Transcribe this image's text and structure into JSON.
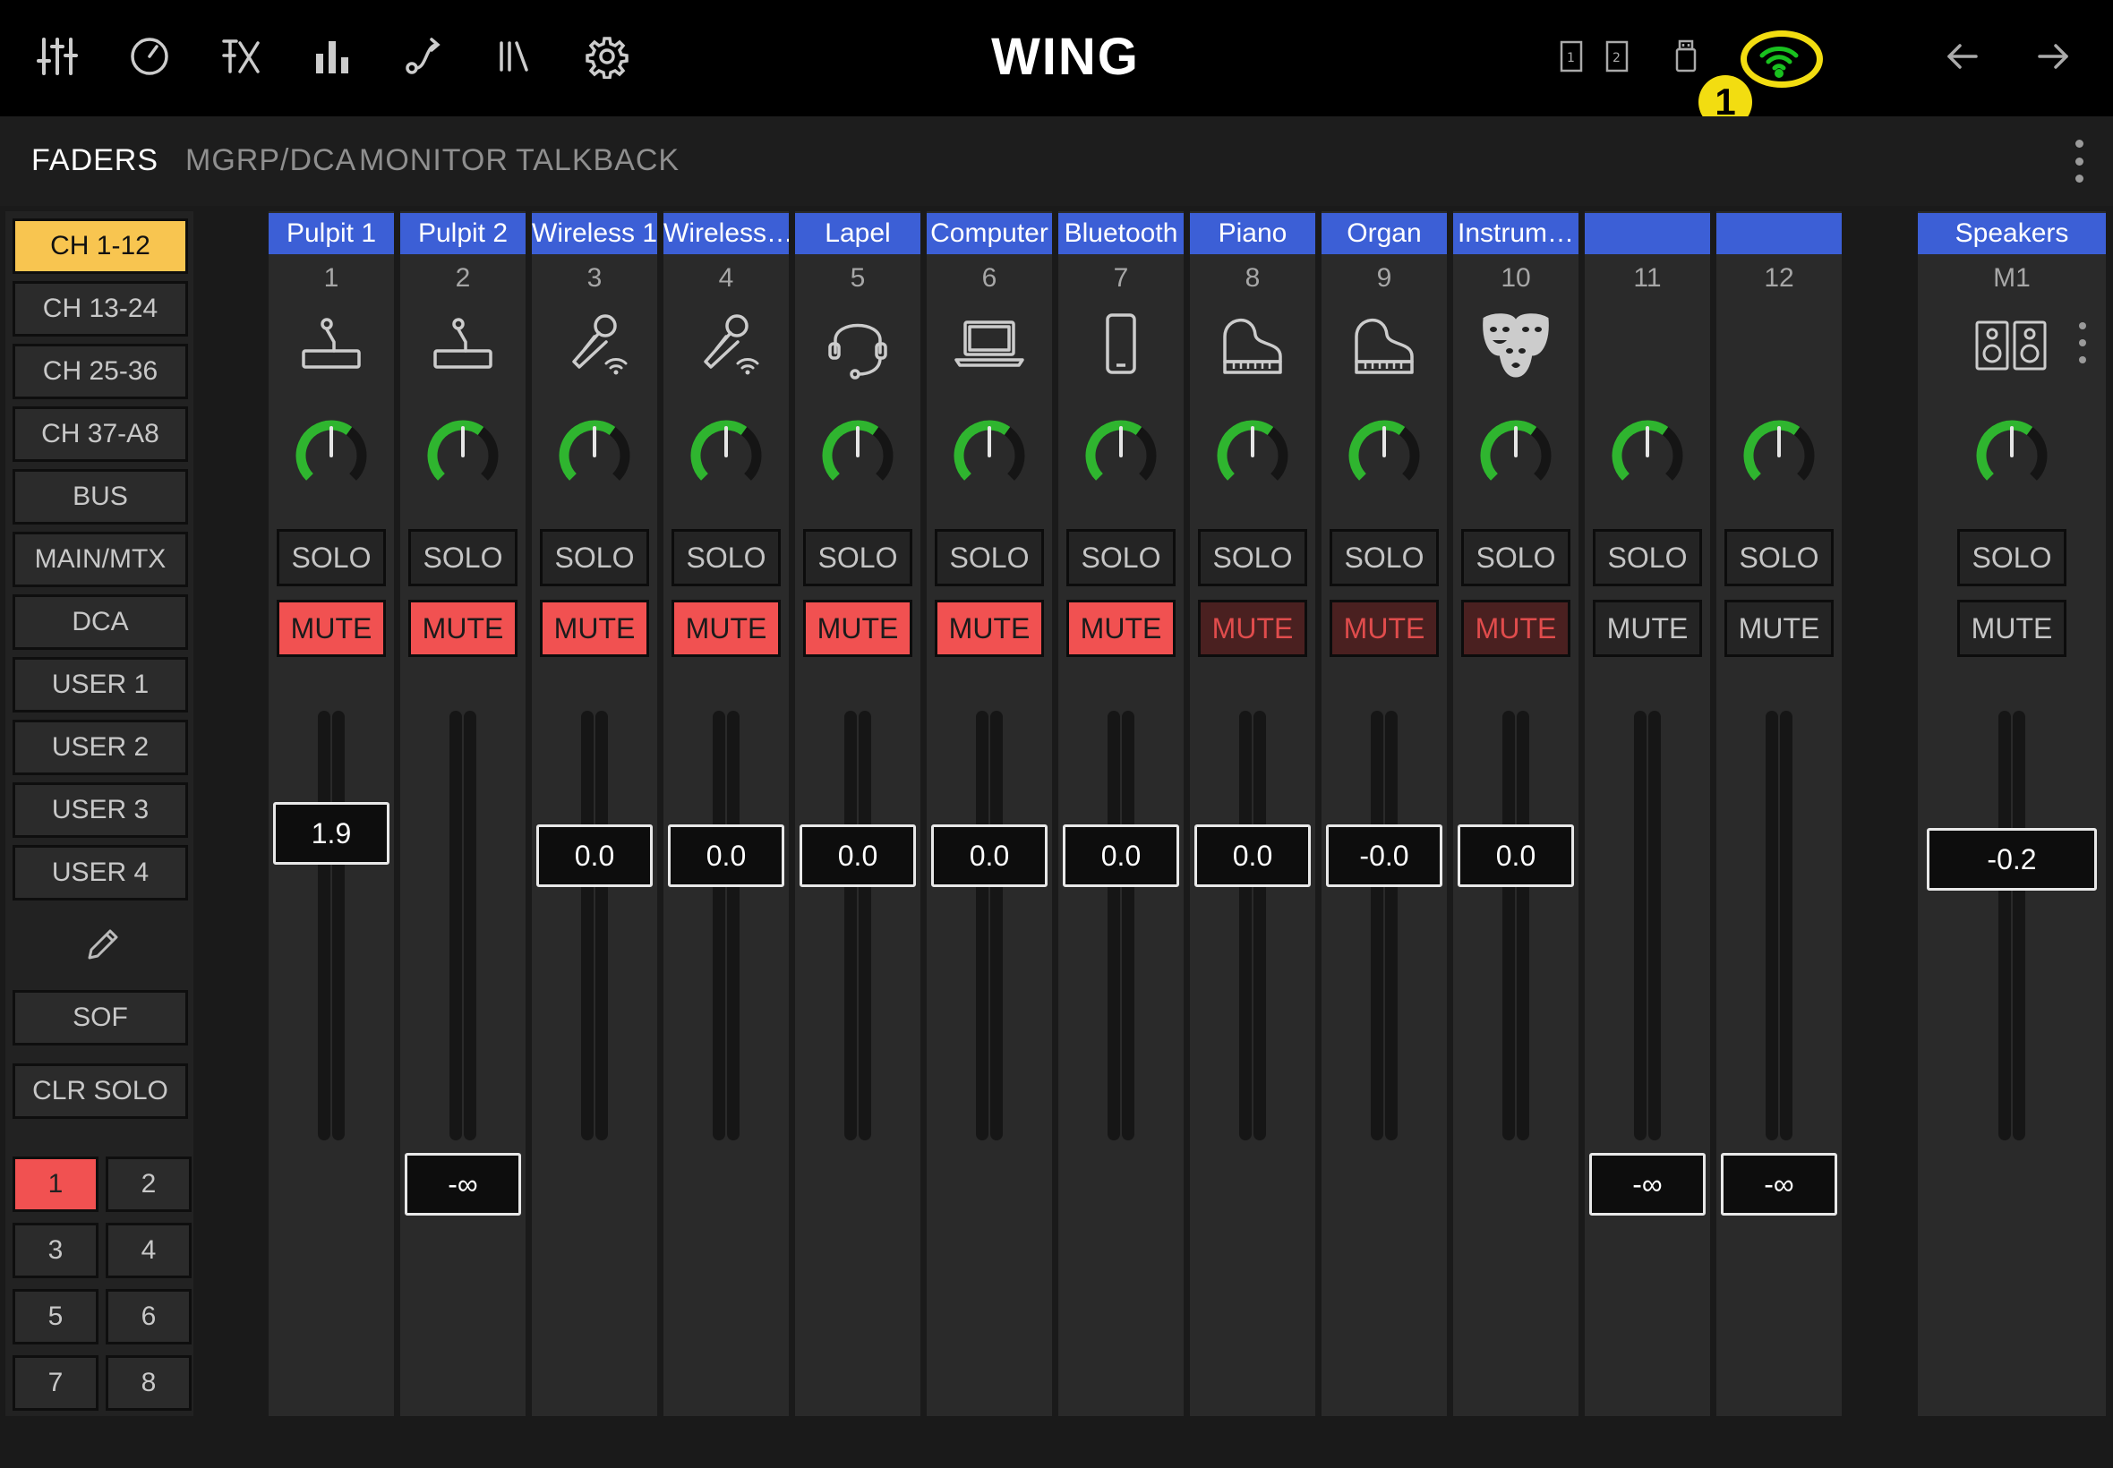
{
  "app": {
    "title": "WING",
    "callout_number": "1"
  },
  "toolbar": {
    "left_icons": [
      "mixer-icon",
      "meter-icon",
      "fx-icon",
      "bar-chart-icon",
      "routing-icon",
      "library-icon",
      "gear-icon"
    ],
    "right_icons": [
      "card-slot-1-icon",
      "card-slot-2-icon",
      "usb-drive-icon",
      "wifi-icon",
      "back-arrow-icon",
      "forward-arrow-icon"
    ],
    "wifi_color": "#19c11f",
    "highlight_color": "#f2dd11"
  },
  "tabs": [
    {
      "label": "FADERS",
      "active": true
    },
    {
      "label": "MGRP/DCA",
      "active": false
    },
    {
      "label": "MONITOR",
      "active": false
    },
    {
      "label": "TALKBACK",
      "active": false
    }
  ],
  "banks": [
    {
      "label": "CH 1-12",
      "active": true
    },
    {
      "label": "CH 13-24",
      "active": false
    },
    {
      "label": "CH 25-36",
      "active": false
    },
    {
      "label": "CH 37-A8",
      "active": false
    },
    {
      "label": "BUS",
      "active": false
    },
    {
      "label": "MAIN/MTX",
      "active": false
    },
    {
      "label": "DCA",
      "active": false
    },
    {
      "label": "USER 1",
      "active": false
    },
    {
      "label": "USER 2",
      "active": false
    },
    {
      "label": "USER 3",
      "active": false
    },
    {
      "label": "USER 4",
      "active": false
    }
  ],
  "edit_icon": "pencil-icon",
  "sof_label": "SOF",
  "clr_solo_label": "CLR SOLO",
  "layers": [
    {
      "label": "1",
      "active": true
    },
    {
      "label": "2",
      "active": false
    },
    {
      "label": "3",
      "active": false
    },
    {
      "label": "4",
      "active": false
    },
    {
      "label": "5",
      "active": false
    },
    {
      "label": "6",
      "active": false
    },
    {
      "label": "7",
      "active": false
    },
    {
      "label": "8",
      "active": false
    }
  ],
  "colors": {
    "name_bar": "#3c5fd6",
    "bank_active": "#f8c550",
    "mute_on": "#f15151",
    "mute_dim_bg": "#4a2020",
    "knob_green": "#2fb52f"
  },
  "strip_labels": {
    "solo": "SOLO",
    "mute": "MUTE"
  },
  "channels": [
    {
      "name": "Pulpit 1",
      "number": "1",
      "icon": "lectern-mic-icon",
      "mute": "on",
      "fader": "1.9",
      "fader_level": 0.8
    },
    {
      "name": "Pulpit 2",
      "number": "2",
      "icon": "lectern-mic-icon",
      "mute": "on",
      "fader": "-∞",
      "fader_level": 0.0
    },
    {
      "name": "Wireless 1",
      "number": "3",
      "icon": "wireless-mic-icon",
      "mute": "on",
      "fader": "0.0",
      "fader_level": 0.75
    },
    {
      "name": "Wireless…",
      "number": "4",
      "icon": "wireless-mic-icon",
      "mute": "on",
      "fader": "0.0",
      "fader_level": 0.75
    },
    {
      "name": "Lapel",
      "number": "5",
      "icon": "headset-mic-icon",
      "mute": "on",
      "fader": "0.0",
      "fader_level": 0.75
    },
    {
      "name": "Computer",
      "number": "6",
      "icon": "laptop-icon",
      "mute": "on",
      "fader": "0.0",
      "fader_level": 0.75
    },
    {
      "name": "Bluetooth",
      "number": "7",
      "icon": "phone-icon",
      "mute": "on",
      "fader": "0.0",
      "fader_level": 0.75
    },
    {
      "name": "Piano",
      "number": "8",
      "icon": "grand-piano-icon",
      "mute": "dim",
      "fader": "0.0",
      "fader_level": 0.75
    },
    {
      "name": "Organ",
      "number": "9",
      "icon": "grand-piano-icon",
      "mute": "dim",
      "fader": "-0.0",
      "fader_level": 0.75
    },
    {
      "name": "Instrum…",
      "number": "10",
      "icon": "theater-masks-icon",
      "mute": "dim",
      "fader": "0.0",
      "fader_level": 0.75
    },
    {
      "name": "",
      "number": "11",
      "icon": "",
      "mute": "off",
      "fader": "-∞",
      "fader_level": 0.0
    },
    {
      "name": "",
      "number": "12",
      "icon": "",
      "mute": "off",
      "fader": "-∞",
      "fader_level": 0.0
    }
  ],
  "main": {
    "name": "Speakers",
    "number": "M1",
    "icon": "speakers-icon",
    "mute": "off",
    "fader": "-0.2",
    "fader_level": 0.74
  }
}
